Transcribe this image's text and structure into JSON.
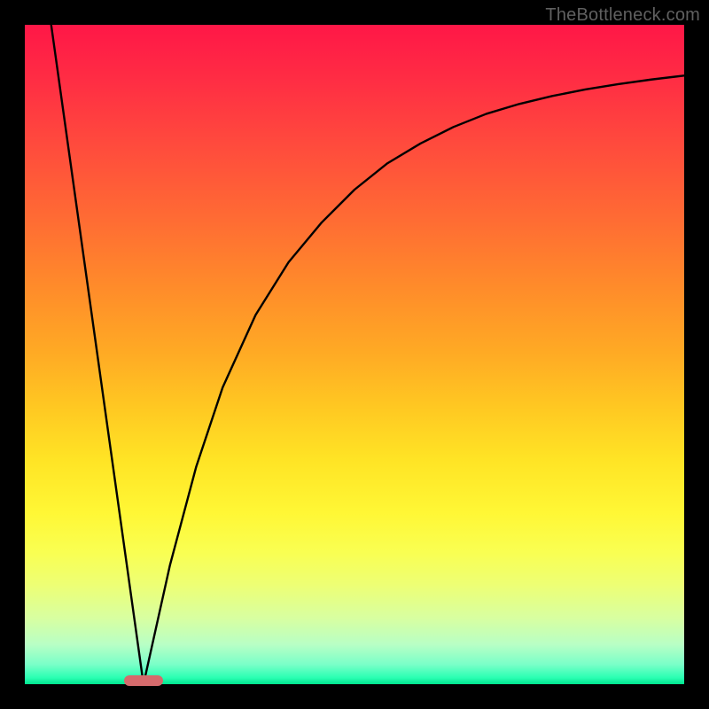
{
  "watermark": "TheBottleneck.com",
  "colors": {
    "background": "#000000",
    "curve": "#000000",
    "marker": "#d56a6c",
    "gradient_top": "#ff1747",
    "gradient_bottom": "#00e58f"
  },
  "chart_data": {
    "type": "line",
    "title": "",
    "xlabel": "",
    "ylabel": "",
    "xlim": [
      0,
      100
    ],
    "ylim": [
      0,
      100
    ],
    "grid": false,
    "legend": false,
    "marker": {
      "x_center": 18,
      "x_width": 6,
      "y": 0
    },
    "series": [
      {
        "name": "curve",
        "segments": [
          {
            "name": "left-branch",
            "x": [
              4,
              18
            ],
            "y": [
              100,
              0
            ]
          },
          {
            "name": "right-branch",
            "x": [
              18,
              22,
              26,
              30,
              35,
              40,
              45,
              50,
              55,
              60,
              65,
              70,
              75,
              80,
              85,
              90,
              95,
              100
            ],
            "y": [
              0,
              18,
              33,
              45,
              56,
              64,
              70,
              75,
              79,
              82,
              84.5,
              86.5,
              88,
              89.2,
              90.2,
              91,
              91.7,
              92.3
            ]
          }
        ]
      }
    ]
  }
}
